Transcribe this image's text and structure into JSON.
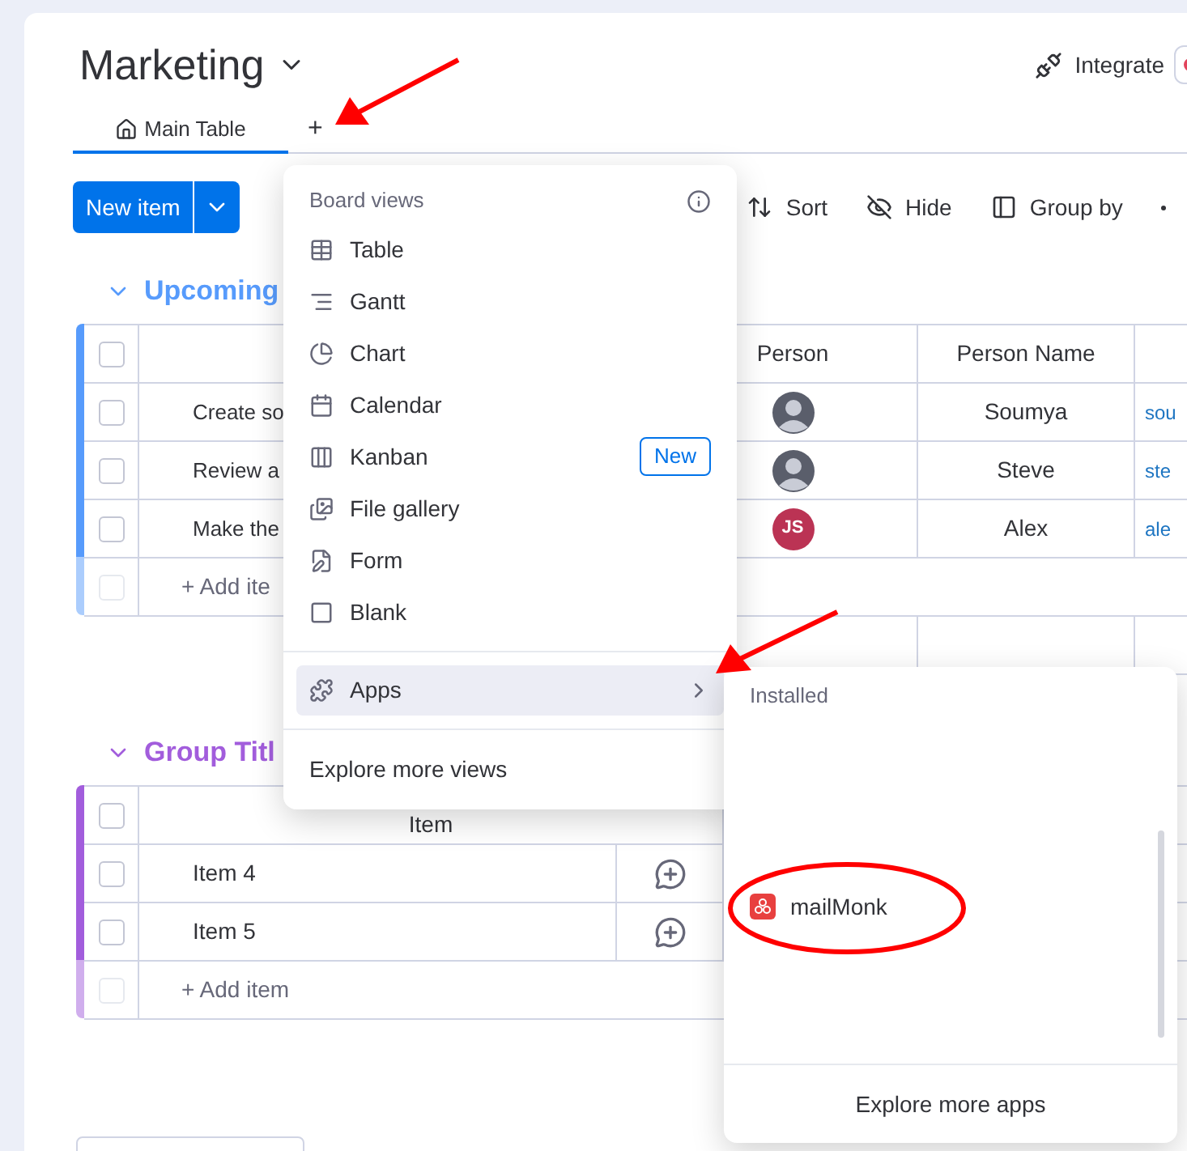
{
  "board": {
    "title": "Marketing",
    "integrate": "Integrate",
    "tabs": [
      {
        "label": "Main Table",
        "selected": true
      }
    ],
    "add_view": "+"
  },
  "toolbar": {
    "new_item": "New item",
    "actions": [
      {
        "label": "Sort"
      },
      {
        "label": "Hide"
      },
      {
        "label": "Group by"
      }
    ]
  },
  "groups": [
    {
      "title": "Upcoming",
      "color": "#579bfc",
      "select_all": {
        "checked": false
      },
      "add_row_checkbox": {
        "disabled": true
      },
      "columns": [
        "",
        "Person",
        "Person Name"
      ],
      "rows": [
        {
          "checked": false,
          "item": "Create so",
          "person": {
            "kind": "photo"
          },
          "person_name": "Soumya",
          "email": "sou"
        },
        {
          "checked": false,
          "item": "Review a",
          "person": {
            "kind": "photo"
          },
          "person_name": "Steve",
          "email": "ste"
        },
        {
          "checked": false,
          "item": "Make the",
          "person": {
            "kind": "initials",
            "initials": "JS",
            "color": "#bb3354"
          },
          "person_name": "Alex",
          "email": "ale"
        }
      ],
      "add_item": "+ Add ite"
    },
    {
      "title": "Group Titl",
      "color": "#a25ddc",
      "select_all": {
        "checked": false
      },
      "add_row_checkbox": {
        "disabled": true
      },
      "columns": [
        "Item"
      ],
      "rows": [
        {
          "checked": false,
          "item": "Item 4"
        },
        {
          "checked": false,
          "item": "Item 5"
        }
      ],
      "add_item": "+ Add item"
    }
  ],
  "board_views_menu": {
    "title": "Board views",
    "items": [
      {
        "label": "Table"
      },
      {
        "label": "Gantt"
      },
      {
        "label": "Chart"
      },
      {
        "label": "Calendar"
      },
      {
        "label": "Kanban",
        "badge": "New"
      },
      {
        "label": "File gallery"
      },
      {
        "label": "Form"
      },
      {
        "label": "Blank"
      }
    ],
    "apps": {
      "label": "Apps",
      "selected": true
    },
    "footer": "Explore more views"
  },
  "apps_menu": {
    "title": "Installed",
    "apps": [
      {
        "name": "mailMonk"
      }
    ],
    "footer": "Explore more apps"
  }
}
